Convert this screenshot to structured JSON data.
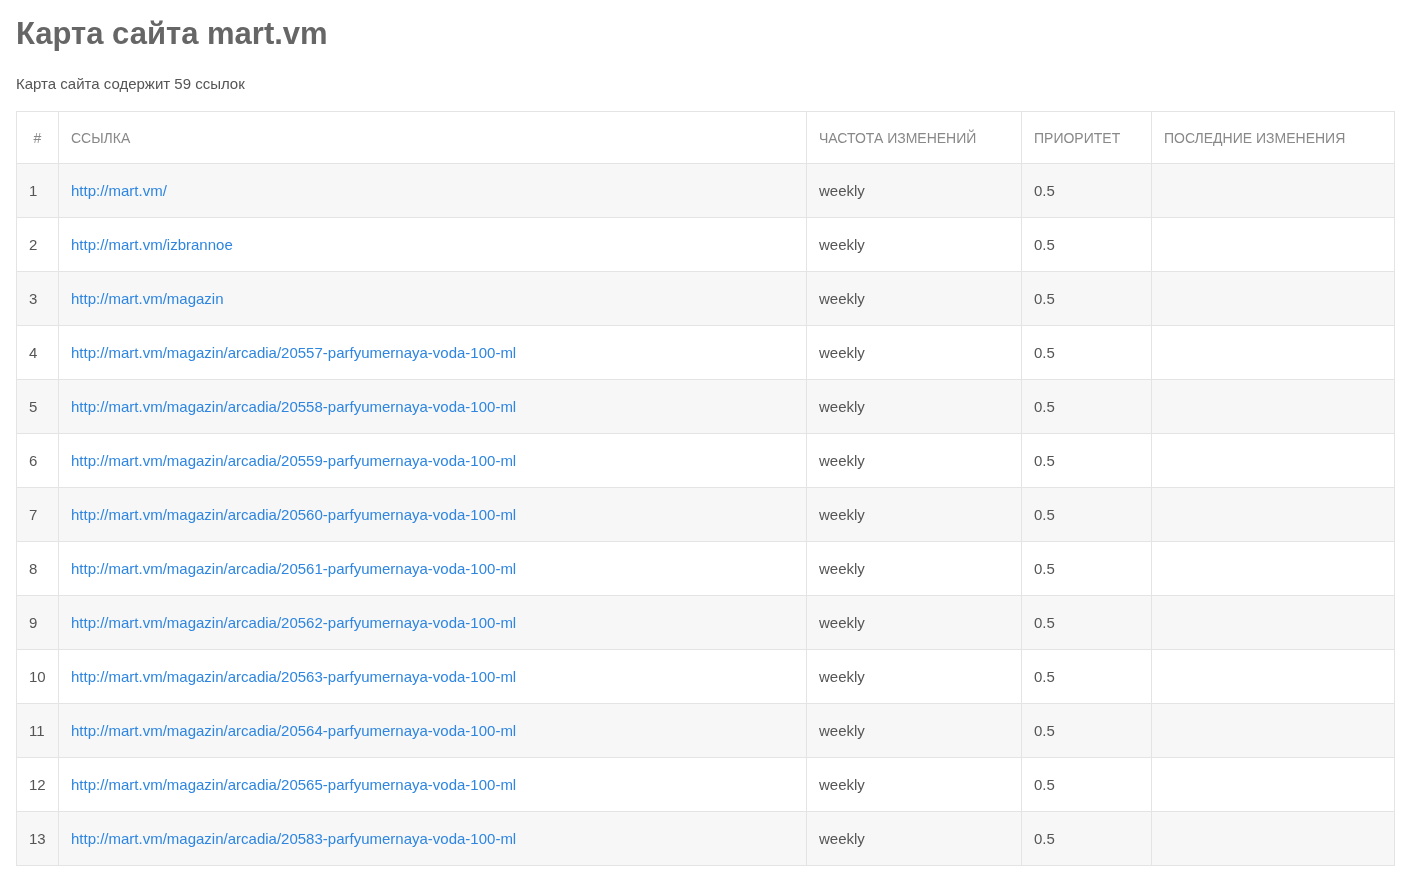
{
  "title": "Карта сайта mart.vm",
  "summary": "Карта сайта содержит 59 ссылок",
  "table": {
    "columns": [
      "#",
      "ССЫЛКА",
      "ЧАСТОТА ИЗМЕНЕНИЙ",
      "ПРИОРИТЕТ",
      "ПОСЛЕДНИЕ ИЗМЕНЕНИЯ"
    ],
    "rows": [
      {
        "index": "1",
        "url": "http://mart.vm/",
        "changefreq": "weekly",
        "priority": "0.5"
      },
      {
        "index": "2",
        "url": "http://mart.vm/izbrannoe",
        "changefreq": "weekly",
        "priority": "0.5"
      },
      {
        "index": "3",
        "url": "http://mart.vm/magazin",
        "changefreq": "weekly",
        "priority": "0.5"
      },
      {
        "index": "4",
        "url": "http://mart.vm/magazin/arcadia/20557-parfyumernaya-voda-100-ml",
        "changefreq": "weekly",
        "priority": "0.5"
      },
      {
        "index": "5",
        "url": "http://mart.vm/magazin/arcadia/20558-parfyumernaya-voda-100-ml",
        "changefreq": "weekly",
        "priority": "0.5"
      },
      {
        "index": "6",
        "url": "http://mart.vm/magazin/arcadia/20559-parfyumernaya-voda-100-ml",
        "changefreq": "weekly",
        "priority": "0.5"
      },
      {
        "index": "7",
        "url": "http://mart.vm/magazin/arcadia/20560-parfyumernaya-voda-100-ml",
        "changefreq": "weekly",
        "priority": "0.5"
      },
      {
        "index": "8",
        "url": "http://mart.vm/magazin/arcadia/20561-parfyumernaya-voda-100-ml",
        "changefreq": "weekly",
        "priority": "0.5"
      },
      {
        "index": "9",
        "url": "http://mart.vm/magazin/arcadia/20562-parfyumernaya-voda-100-ml",
        "changefreq": "weekly",
        "priority": "0.5"
      },
      {
        "index": "10",
        "url": "http://mart.vm/magazin/arcadia/20563-parfyumernaya-voda-100-ml",
        "changefreq": "weekly",
        "priority": "0.5"
      },
      {
        "index": "11",
        "url": "http://mart.vm/magazin/arcadia/20564-parfyumernaya-voda-100-ml",
        "changefreq": "weekly",
        "priority": "0.5"
      },
      {
        "index": "12",
        "url": "http://mart.vm/magazin/arcadia/20565-parfyumernaya-voda-100-ml",
        "changefreq": "weekly",
        "priority": "0.5"
      },
      {
        "index": "13",
        "url": "http://mart.vm/magazin/arcadia/20583-parfyumernaya-voda-100-ml",
        "changefreq": "weekly",
        "priority": "0.5"
      }
    ]
  }
}
